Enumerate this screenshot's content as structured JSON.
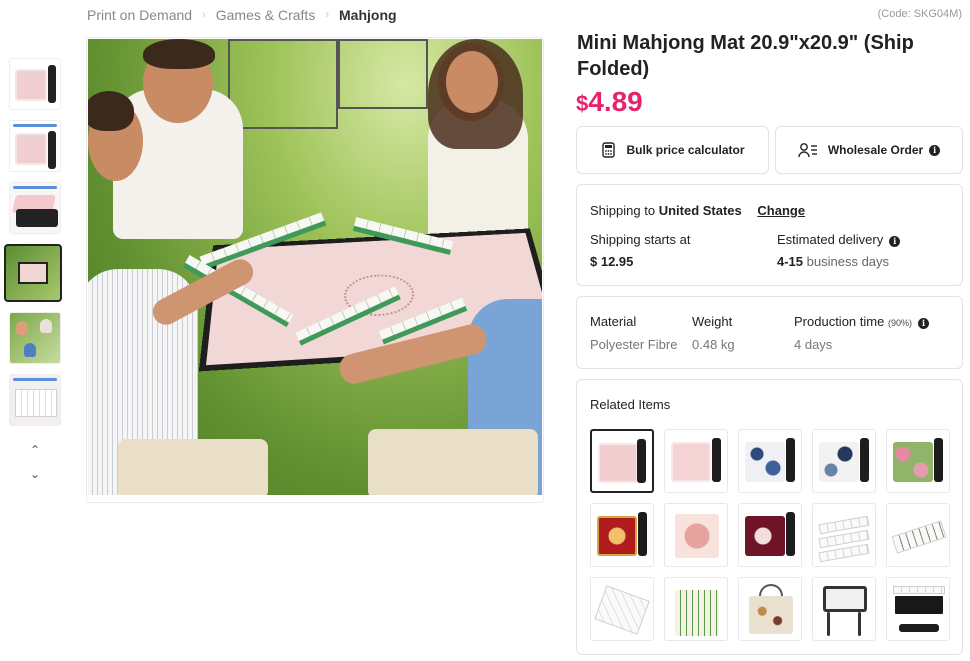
{
  "breadcrumb": {
    "items": [
      "Print on Demand",
      "Games & Crafts",
      "Mahjong"
    ]
  },
  "product": {
    "code": "(Code: SKG04M)",
    "title": "Mini Mahjong Mat 20.9\"x20.9\" (Ship Folded)",
    "price_currency": "$",
    "price_value": "4.89"
  },
  "actions": {
    "bulk_label": "Bulk price calculator",
    "wholesale_label": "Wholesale Order"
  },
  "shipping": {
    "prefix": "Shipping to",
    "country": "United States",
    "change_label": "Change",
    "starts_label": "Shipping starts at",
    "starts_value": "$ 12.95",
    "delivery_label": "Estimated delivery",
    "delivery_range": "4-15",
    "delivery_unit": "business days"
  },
  "specs": {
    "material_label": "Material",
    "material_value": "Polyester Fibre",
    "weight_label": "Weight",
    "weight_value": "0.48 kg",
    "production_label": "Production time",
    "production_pct": "(90%)",
    "production_value": "4 days"
  },
  "related": {
    "header": "Related Items"
  },
  "colors": {
    "price": "#e5226e",
    "mat_pink": "#f1cfd0",
    "tile_green": "#3f9a5a"
  },
  "icons": [
    "chevron-up-icon",
    "chevron-down-icon",
    "calculator-icon",
    "wholesale-person-icon",
    "info-icon"
  ]
}
